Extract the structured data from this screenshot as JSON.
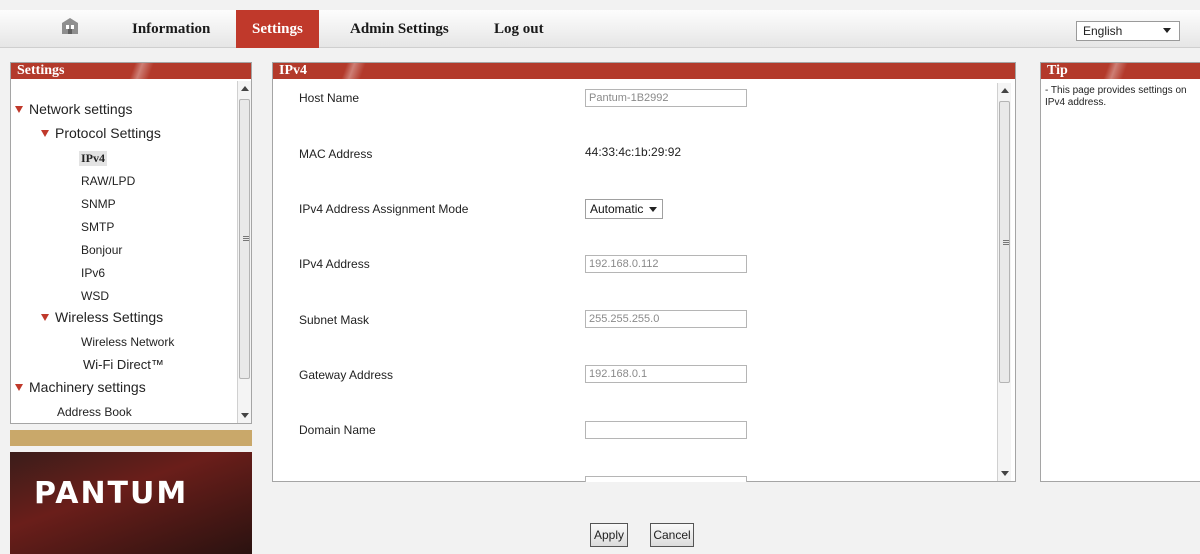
{
  "nav": {
    "home_icon": "home-icon",
    "items": [
      "Information",
      "Settings",
      "Admin Settings",
      "Log out"
    ],
    "active": "Settings"
  },
  "language": {
    "selected": "English"
  },
  "sidebar": {
    "title": "Settings",
    "network_settings": "Network settings",
    "protocol_settings": "Protocol Settings",
    "protocol_items": [
      "IPv4",
      "RAW/LPD",
      "SNMP",
      "SMTP",
      "Bonjour",
      "IPv6",
      "WSD"
    ],
    "wireless_settings": "Wireless Settings",
    "wireless_items": [
      "Wireless Network",
      "Wi-Fi Direct™"
    ],
    "machinery_settings": "Machinery settings",
    "machinery_items": [
      "Address Book"
    ]
  },
  "brand": {
    "logo_text": "PANTUM"
  },
  "main": {
    "title": "IPv4",
    "fields": {
      "host_name_label": "Host Name",
      "host_name_value": "Pantum-1B2992",
      "mac_label": "MAC Address",
      "mac_value": "44:33:4c:1b:29:92",
      "mode_label": "IPv4 Address Assignment Mode",
      "mode_value": "Automatic",
      "ipv4_label": "IPv4 Address",
      "ipv4_value": "192.168.0.112",
      "subnet_label": "Subnet Mask",
      "subnet_value": "255.255.255.0",
      "gateway_label": "Gateway Address",
      "gateway_value": "192.168.0.1",
      "domain_label": "Domain Name",
      "domain_value": ""
    }
  },
  "tip": {
    "title": "Tip",
    "text": "- This page provides settings on IPv4 address."
  },
  "buttons": {
    "apply": "Apply",
    "cancel": "Cancel"
  },
  "colors": {
    "accent": "#c0392b",
    "tan": "#c9a86a"
  }
}
